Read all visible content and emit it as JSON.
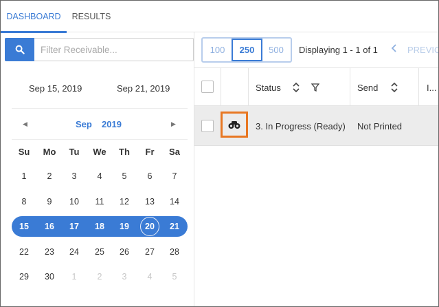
{
  "tabs": [
    {
      "label": "DASHBOARD",
      "active": true
    },
    {
      "label": "RESULTS",
      "active": false
    }
  ],
  "filter": {
    "placeholder": "Filter Receivable...",
    "value": ""
  },
  "date_range": {
    "start": "Sep 15, 2019",
    "end": "Sep 21, 2019"
  },
  "calendar": {
    "month": "Sep",
    "year": "2019",
    "weekdays": [
      "Su",
      "Mo",
      "Tu",
      "We",
      "Th",
      "Fr",
      "Sa"
    ],
    "weeks": [
      [
        "1",
        "2",
        "3",
        "4",
        "5",
        "6",
        "7"
      ],
      [
        "8",
        "9",
        "10",
        "11",
        "12",
        "13",
        "14"
      ],
      [
        "15",
        "16",
        "17",
        "18",
        "19",
        "20",
        "21"
      ],
      [
        "22",
        "23",
        "24",
        "25",
        "26",
        "27",
        "28"
      ],
      [
        "29",
        "30",
        "1",
        "2",
        "3",
        "4",
        "5"
      ]
    ],
    "selected_week_index": 2,
    "today": "20",
    "muted_last_week_from_index": 2
  },
  "pager": {
    "sizes": [
      "100",
      "250",
      "500"
    ],
    "active_size": "250",
    "displaying": "Displaying 1 - 1 of 1",
    "prev_label": "PREVIOUS"
  },
  "grid": {
    "headers": {
      "status": "Status",
      "send": "Send",
      "extra": "I..."
    },
    "rows": [
      {
        "status": "3. In Progress (Ready)",
        "send": "Not Printed"
      }
    ]
  },
  "icons": {
    "search": "search-icon",
    "sort": "sort-icon",
    "filter": "filter-icon",
    "view": "binoculars-icon",
    "prev_chevron": "chevron-left-icon",
    "cal_prev": "triangle-left-icon",
    "cal_next": "triangle-right-icon"
  },
  "colors": {
    "accent": "#3a7bd5",
    "highlight_border": "#e87722",
    "row_bg": "#ececec"
  }
}
